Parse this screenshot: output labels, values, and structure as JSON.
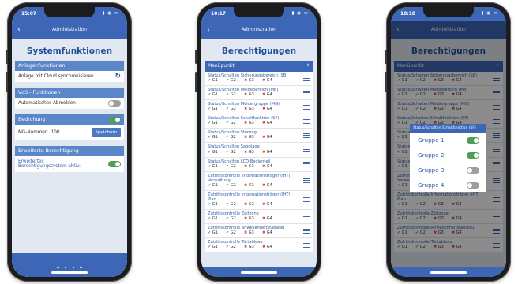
{
  "phone1": {
    "time": "15:07",
    "nav_title": "Administration",
    "page_title": "Systemfunktionen",
    "section1": {
      "header": "Anlagenfunktionen",
      "row_label": "Anlage mit Cloud synchronisieren"
    },
    "section2": {
      "header": "VdS - Funktionen",
      "row_label": "Automatisches Abmelden"
    },
    "section3": {
      "header": "Bedrohung",
      "mg_label": "MG-Nummer:",
      "mg_value": "100",
      "save_button": "Speichern"
    },
    "section4": {
      "header": "Erweiterte Berechtigung",
      "row_label_line1": "Erweitertes",
      "row_label_line2": "Berechtigungssystem aktiv:"
    }
  },
  "phone2": {
    "time": "10:17",
    "nav_title": "Administration",
    "page_title": "Berechtigungen",
    "menu_header": "Menüpunkt",
    "items": [
      {
        "name": "Status/Schalten Sicherungsbereich (SB)",
        "g": [
          "ok",
          "ok",
          "no",
          "no"
        ]
      },
      {
        "name": "Status/Schalten Meldebereich (MB)",
        "g": [
          "ok",
          "ok",
          "no",
          "no"
        ]
      },
      {
        "name": "Status/Schalten Meldergruppe (MG)",
        "g": [
          "ok",
          "ok",
          "no",
          "no"
        ]
      },
      {
        "name": "Status/Schalten Schaltfunktion (SF)",
        "g": [
          "ok",
          "ok",
          "no",
          "no"
        ]
      },
      {
        "name": "Status/Schalten Störung",
        "g": [
          "ok",
          "ok",
          "no",
          "no"
        ]
      },
      {
        "name": "Status/Schalten Sabotage",
        "g": [
          "ok",
          "ok",
          "no",
          "no"
        ]
      },
      {
        "name": "Status/Schalten LCD-Bedienteil",
        "g": [
          "ok",
          "ok",
          "no",
          "no"
        ]
      },
      {
        "name": "Zutrittskontrolle Informationsträger (IHT) Verwaltung",
        "g": [
          "ok",
          "ok",
          "no",
          "no"
        ]
      },
      {
        "name": "Zutrittskontrolle Informationsträger (IHT) Plan",
        "g": [
          "ok",
          "ok",
          "no",
          "no"
        ]
      },
      {
        "name": "Zutrittskontrolle Zeitzone",
        "g": [
          "ok",
          "ok",
          "no",
          "no"
        ]
      },
      {
        "name": "Zutrittskontrolle Anwesenheitstableau",
        "g": [
          "ok",
          "ok",
          "no",
          "no"
        ]
      },
      {
        "name": "Zutrittskontrolle Türtableau",
        "g": [
          "ok",
          "ok",
          "no",
          "no"
        ]
      }
    ],
    "group_labels": [
      "G1",
      "G2",
      "G3",
      "G4"
    ]
  },
  "phone3": {
    "time": "10:18",
    "nav_title": "Administration",
    "page_title": "Berechtigungen",
    "menu_header": "Menüpunkt",
    "popup": {
      "header": "Status/Schalten Schaltfunktion (SF)",
      "groups": [
        {
          "label": "Gruppe 1",
          "on": true
        },
        {
          "label": "Gruppe 2",
          "on": true
        },
        {
          "label": "Gruppe 3",
          "on": false
        },
        {
          "label": "Gruppe 4",
          "on": false
        }
      ]
    }
  },
  "icons": {
    "ok": "✔",
    "no": "✖",
    "back": "‹",
    "chevron": "›",
    "sync": "↻",
    "status": "▮ ◉ ▭"
  },
  "colors": {
    "brand_blue": "#3d67b6",
    "section_blue": "#5b86c8",
    "toggle_on": "#4f9e57",
    "toggle_off": "#9e9e9e",
    "ok": "#47a04f",
    "no": "#e0413b"
  }
}
